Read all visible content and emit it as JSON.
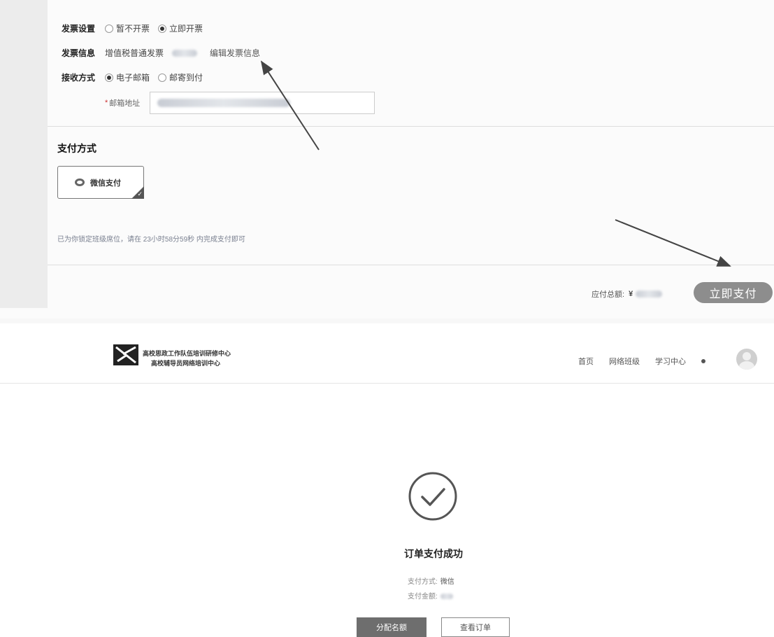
{
  "invoice": {
    "settings_label": "发票设置",
    "option_no": "暂不开票",
    "option_now": "立即开票",
    "info_label": "发票信息",
    "info_value": "增值税普通发票",
    "edit_link": "编辑发票信息",
    "receive_label": "接收方式",
    "receive_email": "电子邮箱",
    "receive_post": "邮寄到付",
    "email_label": "邮箱地址"
  },
  "payment": {
    "title": "支付方式",
    "method": "微信支付",
    "notice": "已为你锁定班级席位，请在 23小时58分59秒 内完成支付即可",
    "total_label": "应付总额:",
    "currency": "¥",
    "pay_button": "立即支付"
  },
  "site": {
    "brand_line1": "高校思政工作队伍培训研修中心",
    "brand_line2": "高校辅导员网络培训中心",
    "nav": [
      "首页",
      "网络班级",
      "学习中心"
    ]
  },
  "success": {
    "title": "订单支付成功",
    "method_label": "支付方式:",
    "method_value": "微信",
    "amount_label": "支付金额:",
    "assign_button": "分配名额",
    "view_order_button": "查看订单"
  },
  "colors": {
    "primary_button": "#8d8d8d",
    "dark_button": "#6e6e6e",
    "arrow": "#444444"
  }
}
